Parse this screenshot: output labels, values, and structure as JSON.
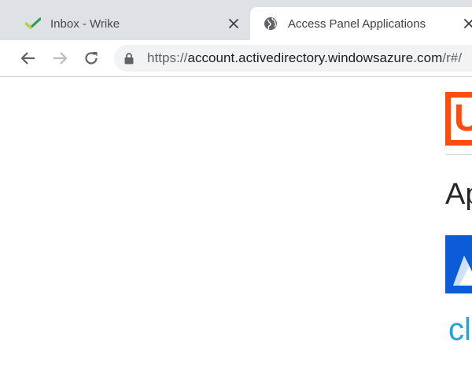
{
  "browser": {
    "tabs": [
      {
        "title": "Inbox - Wrike",
        "icon": "wrike-checkmark-icon",
        "active": false
      },
      {
        "title": "Access Panel Applications",
        "icon": "globe-icon",
        "active": true
      }
    ],
    "toolbar": {
      "back_icon": "back-arrow-icon",
      "forward_icon": "forward-arrow-icon",
      "reload_icon": "reload-icon",
      "lock_icon": "lock-icon"
    },
    "address_bar": {
      "scheme": "https://",
      "host": "account.activedirectory.windowsazure.com",
      "path": "/r#/"
    }
  },
  "page": {
    "logo_letter": "U",
    "heading": "Ap",
    "app_text": "cla"
  },
  "colors": {
    "tabstrip": "#dee1e6",
    "logo": "#ff4d12",
    "app_tile": "#0b5cd6",
    "app_text": "#22a3d8"
  }
}
